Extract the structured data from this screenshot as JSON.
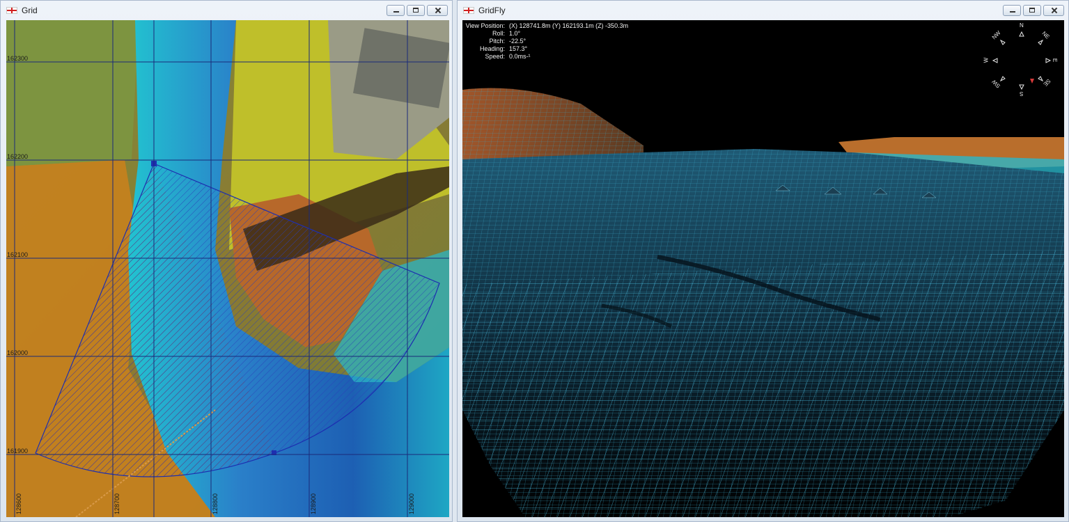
{
  "windows": {
    "grid": {
      "title": "Grid"
    },
    "gridfly": {
      "title": "GridFly"
    }
  },
  "grid_view": {
    "y_labels": [
      "162300",
      "162200",
      "162100",
      "162000",
      "161900"
    ],
    "x_labels": [
      "128600",
      "128700",
      "128800",
      "128900",
      "129000"
    ]
  },
  "hud": {
    "view_position_label": "View Position:",
    "view_position_value": "(X) 128741.8m (Y) 162193.1m (Z) -350.3m",
    "roll_label": "Roll:",
    "roll_value": "1.0°",
    "pitch_label": "Pitch:",
    "pitch_value": "-22.5°",
    "heading_label": "Heading:",
    "heading_value": "157.3°",
    "speed_label": "Speed:",
    "speed_value": "0.0ms-¹"
  },
  "compass": {
    "n": "N",
    "ne": "NE",
    "e": "E",
    "se": "SE",
    "s": "S",
    "sw": "SW",
    "w": "W",
    "nw": "NW"
  },
  "colors": {
    "window_bg": "#dce5ef",
    "hatch_blue": "#2a3fb8",
    "hatch_orange": "#b54a1c",
    "mesh": "#49b7d8"
  }
}
